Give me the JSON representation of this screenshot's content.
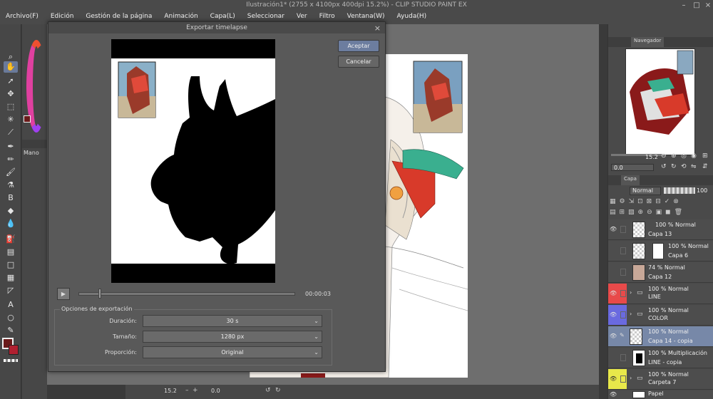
{
  "window": {
    "title": "Ilustración1* (2755 x 4100px 400dpi 15.2%) - CLIP STUDIO PAINT EX"
  },
  "menu": [
    "Archivo(F)",
    "Edición",
    "Gestión de la página",
    "Animación",
    "Capa(L)",
    "Seleccionar",
    "Ver",
    "Filtro",
    "Ventana(W)",
    "Ayuda(H)"
  ],
  "left_panel": {
    "tool_label": "Mano"
  },
  "dialog": {
    "title": "Exportar timelapse",
    "ok_label": "Aceptar",
    "cancel_label": "Cancelar",
    "timecode": "00:00:03",
    "playback_progress": 0.1,
    "options_label": "Opciones de exportación",
    "duration_label": "Duración:",
    "duration_value": "30 s",
    "size_label": "Tamaño:",
    "size_value": "1280 px",
    "ratio_label": "Proporción:",
    "ratio_value": "Original"
  },
  "navigator": {
    "tab": "Navegador",
    "zoom": "15.2",
    "rotation": "0.0"
  },
  "layers_panel": {
    "tab": "Capa",
    "blend_mode": "Normal",
    "opacity": "100",
    "layers": [
      {
        "mode": "100 % Normal",
        "name": "Capa 13",
        "visible": true,
        "color": ""
      },
      {
        "mode": "100 % Normal",
        "name": "Capa 6",
        "visible": false,
        "color": ""
      },
      {
        "mode": "74 % Normal",
        "name": "Capa 12",
        "visible": false,
        "color": ""
      },
      {
        "mode": "100 % Normal",
        "name": "LINE",
        "visible": true,
        "color": "#e84a4a"
      },
      {
        "mode": "100 % Normal",
        "name": "COLOR",
        "visible": true,
        "color": "#6a6ae0"
      },
      {
        "mode": "100 % Normal",
        "name": "Capa 14 - copia",
        "visible": true,
        "color": ""
      },
      {
        "mode": "100 % Multiplicación",
        "name": "LINE - copia",
        "visible": false,
        "color": ""
      },
      {
        "mode": "100 % Normal",
        "name": "Carpeta 7",
        "visible": true,
        "color": "#e8e84a"
      },
      {
        "mode": "",
        "name": "Papel",
        "visible": true,
        "color": ""
      }
    ]
  },
  "bottom": {
    "zoom": "15.2",
    "rotation": "0.0"
  }
}
